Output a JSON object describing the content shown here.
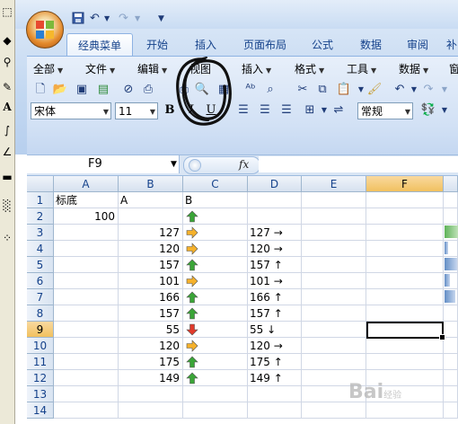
{
  "window": {
    "tabs_visible_partial": "补"
  },
  "qat": {
    "save": "save-icon",
    "undo": "undo-icon",
    "redo": "redo-icon",
    "customize": "▼"
  },
  "ribbon": {
    "tabs": [
      {
        "label": "经典菜单",
        "active": true
      },
      {
        "label": "开始"
      },
      {
        "label": "插入"
      },
      {
        "label": "页面布局"
      },
      {
        "label": "公式"
      },
      {
        "label": "数据"
      },
      {
        "label": "审阅"
      }
    ],
    "menus": [
      {
        "label": "全部"
      },
      {
        "label": "文件"
      },
      {
        "label": "编辑"
      },
      {
        "label": "视图"
      },
      {
        "label": "插入"
      },
      {
        "label": "格式"
      },
      {
        "label": "工具"
      },
      {
        "label": "数据"
      },
      {
        "label": "窗"
      }
    ],
    "font_name": "宋体",
    "font_size": "11",
    "bold": "B",
    "italic": "I",
    "underline": "U",
    "number_format": "常规"
  },
  "formula_bar": {
    "name_box": "F9",
    "fx": "fx",
    "value": ""
  },
  "sheet": {
    "columns": [
      "A",
      "B",
      "C",
      "D",
      "E",
      "F"
    ],
    "rows": [
      "1",
      "2",
      "3",
      "4",
      "5",
      "6",
      "7",
      "8",
      "9",
      "10",
      "11",
      "12",
      "13",
      "14"
    ],
    "selected_cell": {
      "col": "F",
      "row": "9"
    },
    "cells": {
      "A1": "标底",
      "B1": "A",
      "C1": "B",
      "A2": "100",
      "B3": "127",
      "D3": "127 →",
      "B4": "120",
      "D4": "120 →",
      "B5": "157",
      "D5": "157 ↑",
      "B6": "101",
      "D6": "101 →",
      "B7": "166",
      "D7": "166 ↑",
      "B8": "157",
      "D8": "157 ↑",
      "B9": "55",
      "D9": "55 ↓",
      "B10": "120",
      "D10": "120 →",
      "B11": "175",
      "D11": "175 ↑",
      "B12": "149",
      "D12": "149 ↑"
    },
    "icon_set": [
      {
        "cell": "C2",
        "icon": "green-up-arrow"
      },
      {
        "cell": "C3",
        "icon": "yellow-right-arrow"
      },
      {
        "cell": "C4",
        "icon": "yellow-right-arrow"
      },
      {
        "cell": "C5",
        "icon": "green-up-arrow"
      },
      {
        "cell": "C6",
        "icon": "yellow-right-arrow"
      },
      {
        "cell": "C7",
        "icon": "green-up-arrow"
      },
      {
        "cell": "C8",
        "icon": "green-up-arrow"
      },
      {
        "cell": "C9",
        "icon": "red-down-arrow"
      },
      {
        "cell": "C10",
        "icon": "yellow-right-arrow"
      },
      {
        "cell": "C11",
        "icon": "green-up-arrow"
      },
      {
        "cell": "C12",
        "icon": "green-up-arrow"
      }
    ],
    "colors": {
      "green": "#3aa537",
      "yellow": "#f5b12b",
      "red": "#e13a2b",
      "databar": "#638ec6"
    }
  },
  "watermark": {
    "text": "Bai",
    "suffix": "经验"
  }
}
